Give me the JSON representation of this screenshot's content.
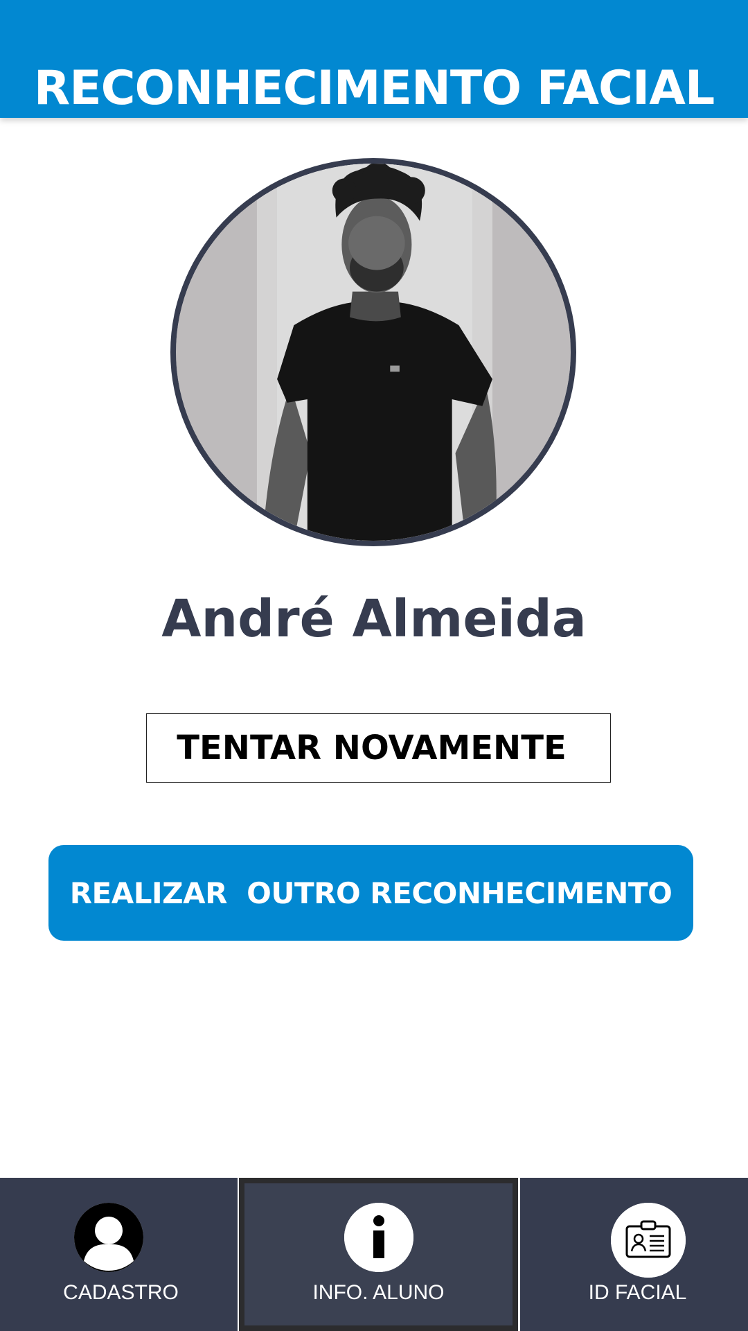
{
  "header": {
    "title": "RECONHECIMENTO FACIAL"
  },
  "profile": {
    "name": "André Almeida",
    "photo_alt": "André Almeida"
  },
  "actions": {
    "retry_label": "TENTAR NOVAMENTE",
    "again_label": "REALIZAR  OUTRO RECONHECIMENTO"
  },
  "bottom_nav": {
    "active": "info",
    "items": [
      {
        "label": "CADASTRO",
        "icon": "user-silhouette-icon"
      },
      {
        "label": "INFO. ALUNO",
        "icon": "info-icon"
      },
      {
        "label": "ID FACIAL",
        "icon": "id-card-icon"
      }
    ]
  },
  "colors": {
    "primary": "#0288d1",
    "dark": "#363c4f",
    "white": "#ffffff"
  }
}
